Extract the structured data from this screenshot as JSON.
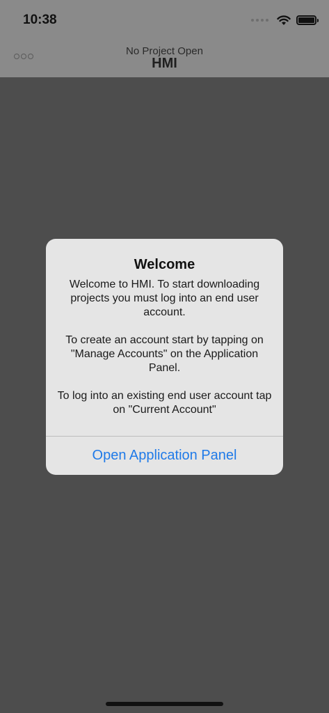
{
  "status_bar": {
    "time": "10:38"
  },
  "nav": {
    "subtitle": "No Project Open",
    "title": "HMI"
  },
  "alert": {
    "title": "Welcome",
    "paragraphs": [
      "Welcome to HMI. To start downloading projects you must log into an end user account.",
      "To create an account start by tapping on \"Manage Accounts\" on the Application Panel.",
      "To log into an existing end user account tap on \"Current Account\""
    ],
    "action_label": "Open Application Panel"
  },
  "colors": {
    "accent": "#1f7ae8",
    "overlay": "#4d4d4d",
    "alert_bg": "#e5e5e5"
  }
}
